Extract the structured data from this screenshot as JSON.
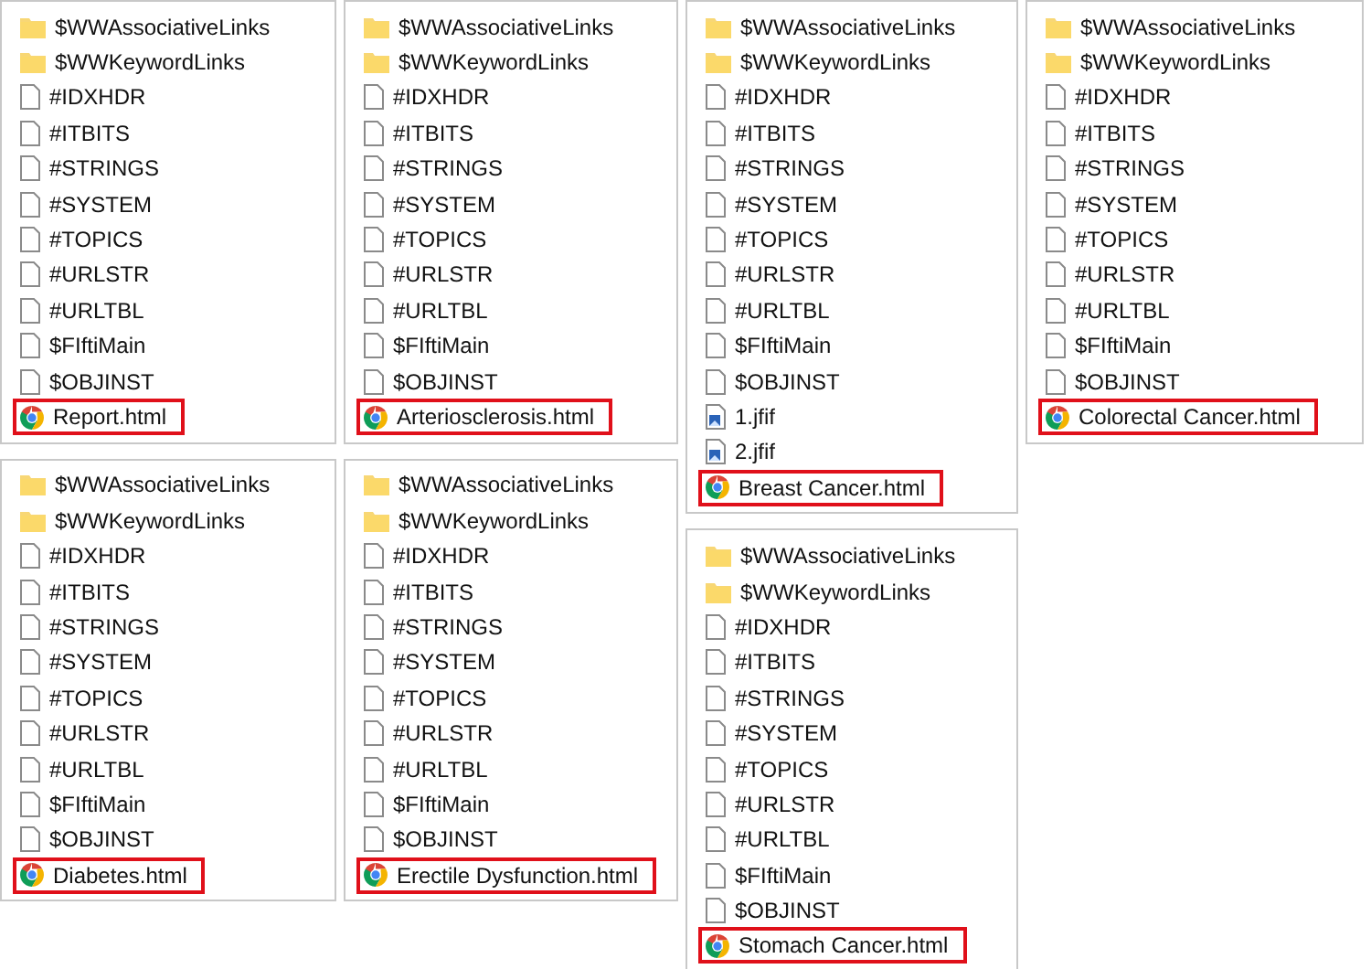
{
  "columns": [
    {
      "panels": [
        {
          "items": [
            {
              "kind": "folder",
              "name": "$WWAssociativeLinks",
              "highlighted": false
            },
            {
              "kind": "folder",
              "name": "$WWKeywordLinks",
              "highlighted": false
            },
            {
              "kind": "file",
              "name": "#IDXHDR",
              "highlighted": false
            },
            {
              "kind": "file",
              "name": "#ITBITS",
              "highlighted": false
            },
            {
              "kind": "file",
              "name": "#STRINGS",
              "highlighted": false
            },
            {
              "kind": "file",
              "name": "#SYSTEM",
              "highlighted": false
            },
            {
              "kind": "file",
              "name": "#TOPICS",
              "highlighted": false
            },
            {
              "kind": "file",
              "name": "#URLSTR",
              "highlighted": false
            },
            {
              "kind": "file",
              "name": "#URLTBL",
              "highlighted": false
            },
            {
              "kind": "file",
              "name": "$FIftiMain",
              "highlighted": false
            },
            {
              "kind": "file",
              "name": "$OBJINST",
              "highlighted": false
            },
            {
              "kind": "html",
              "name": "Report.html",
              "highlighted": true
            }
          ]
        },
        {
          "items": [
            {
              "kind": "folder",
              "name": "$WWAssociativeLinks",
              "highlighted": false
            },
            {
              "kind": "folder",
              "name": "$WWKeywordLinks",
              "highlighted": false
            },
            {
              "kind": "file",
              "name": "#IDXHDR",
              "highlighted": false
            },
            {
              "kind": "file",
              "name": "#ITBITS",
              "highlighted": false
            },
            {
              "kind": "file",
              "name": "#STRINGS",
              "highlighted": false
            },
            {
              "kind": "file",
              "name": "#SYSTEM",
              "highlighted": false
            },
            {
              "kind": "file",
              "name": "#TOPICS",
              "highlighted": false
            },
            {
              "kind": "file",
              "name": "#URLSTR",
              "highlighted": false
            },
            {
              "kind": "file",
              "name": "#URLTBL",
              "highlighted": false
            },
            {
              "kind": "file",
              "name": "$FIftiMain",
              "highlighted": false
            },
            {
              "kind": "file",
              "name": "$OBJINST",
              "highlighted": false
            },
            {
              "kind": "html",
              "name": "Diabetes.html",
              "highlighted": true
            }
          ]
        }
      ]
    },
    {
      "panels": [
        {
          "items": [
            {
              "kind": "folder",
              "name": "$WWAssociativeLinks",
              "highlighted": false
            },
            {
              "kind": "folder",
              "name": "$WWKeywordLinks",
              "highlighted": false
            },
            {
              "kind": "file",
              "name": "#IDXHDR",
              "highlighted": false
            },
            {
              "kind": "file",
              "name": "#ITBITS",
              "highlighted": false
            },
            {
              "kind": "file",
              "name": "#STRINGS",
              "highlighted": false
            },
            {
              "kind": "file",
              "name": "#SYSTEM",
              "highlighted": false
            },
            {
              "kind": "file",
              "name": "#TOPICS",
              "highlighted": false
            },
            {
              "kind": "file",
              "name": "#URLSTR",
              "highlighted": false
            },
            {
              "kind": "file",
              "name": "#URLTBL",
              "highlighted": false
            },
            {
              "kind": "file",
              "name": "$FIftiMain",
              "highlighted": false
            },
            {
              "kind": "file",
              "name": "$OBJINST",
              "highlighted": false
            },
            {
              "kind": "html",
              "name": "Arteriosclerosis.html",
              "highlighted": true
            }
          ]
        },
        {
          "items": [
            {
              "kind": "folder",
              "name": "$WWAssociativeLinks",
              "highlighted": false
            },
            {
              "kind": "folder",
              "name": "$WWKeywordLinks",
              "highlighted": false
            },
            {
              "kind": "file",
              "name": "#IDXHDR",
              "highlighted": false
            },
            {
              "kind": "file",
              "name": "#ITBITS",
              "highlighted": false
            },
            {
              "kind": "file",
              "name": "#STRINGS",
              "highlighted": false
            },
            {
              "kind": "file",
              "name": "#SYSTEM",
              "highlighted": false
            },
            {
              "kind": "file",
              "name": "#TOPICS",
              "highlighted": false
            },
            {
              "kind": "file",
              "name": "#URLSTR",
              "highlighted": false
            },
            {
              "kind": "file",
              "name": "#URLTBL",
              "highlighted": false
            },
            {
              "kind": "file",
              "name": "$FIftiMain",
              "highlighted": false
            },
            {
              "kind": "file",
              "name": "$OBJINST",
              "highlighted": false
            },
            {
              "kind": "html",
              "name": "Erectile Dysfunction.html",
              "highlighted": true
            }
          ]
        }
      ]
    },
    {
      "panels": [
        {
          "items": [
            {
              "kind": "folder",
              "name": "$WWAssociativeLinks",
              "highlighted": false
            },
            {
              "kind": "folder",
              "name": "$WWKeywordLinks",
              "highlighted": false
            },
            {
              "kind": "file",
              "name": "#IDXHDR",
              "highlighted": false
            },
            {
              "kind": "file",
              "name": "#ITBITS",
              "highlighted": false
            },
            {
              "kind": "file",
              "name": "#STRINGS",
              "highlighted": false
            },
            {
              "kind": "file",
              "name": "#SYSTEM",
              "highlighted": false
            },
            {
              "kind": "file",
              "name": "#TOPICS",
              "highlighted": false
            },
            {
              "kind": "file",
              "name": "#URLSTR",
              "highlighted": false
            },
            {
              "kind": "file",
              "name": "#URLTBL",
              "highlighted": false
            },
            {
              "kind": "file",
              "name": "$FIftiMain",
              "highlighted": false
            },
            {
              "kind": "file",
              "name": "$OBJINST",
              "highlighted": false
            },
            {
              "kind": "image",
              "name": "1.jfif",
              "highlighted": false
            },
            {
              "kind": "image",
              "name": "2.jfif",
              "highlighted": false
            },
            {
              "kind": "html",
              "name": "Breast Cancer.html",
              "highlighted": true
            }
          ]
        },
        {
          "items": [
            {
              "kind": "folder",
              "name": "$WWAssociativeLinks",
              "highlighted": false
            },
            {
              "kind": "folder",
              "name": "$WWKeywordLinks",
              "highlighted": false
            },
            {
              "kind": "file",
              "name": "#IDXHDR",
              "highlighted": false
            },
            {
              "kind": "file",
              "name": "#ITBITS",
              "highlighted": false
            },
            {
              "kind": "file",
              "name": "#STRINGS",
              "highlighted": false
            },
            {
              "kind": "file",
              "name": "#SYSTEM",
              "highlighted": false
            },
            {
              "kind": "file",
              "name": "#TOPICS",
              "highlighted": false
            },
            {
              "kind": "file",
              "name": "#URLSTR",
              "highlighted": false
            },
            {
              "kind": "file",
              "name": "#URLTBL",
              "highlighted": false
            },
            {
              "kind": "file",
              "name": "$FIftiMain",
              "highlighted": false
            },
            {
              "kind": "file",
              "name": "$OBJINST",
              "highlighted": false
            },
            {
              "kind": "html",
              "name": "Stomach Cancer.html",
              "highlighted": true
            }
          ]
        }
      ]
    },
    {
      "panels": [
        {
          "items": [
            {
              "kind": "folder",
              "name": "$WWAssociativeLinks",
              "highlighted": false
            },
            {
              "kind": "folder",
              "name": "$WWKeywordLinks",
              "highlighted": false
            },
            {
              "kind": "file",
              "name": "#IDXHDR",
              "highlighted": false
            },
            {
              "kind": "file",
              "name": "#ITBITS",
              "highlighted": false
            },
            {
              "kind": "file",
              "name": "#STRINGS",
              "highlighted": false
            },
            {
              "kind": "file",
              "name": "#SYSTEM",
              "highlighted": false
            },
            {
              "kind": "file",
              "name": "#TOPICS",
              "highlighted": false
            },
            {
              "kind": "file",
              "name": "#URLSTR",
              "highlighted": false
            },
            {
              "kind": "file",
              "name": "#URLTBL",
              "highlighted": false
            },
            {
              "kind": "file",
              "name": "$FIftiMain",
              "highlighted": false
            },
            {
              "kind": "file",
              "name": "$OBJINST",
              "highlighted": false
            },
            {
              "kind": "html",
              "name": "Colorectal Cancer.html",
              "highlighted": true
            }
          ]
        }
      ]
    }
  ]
}
